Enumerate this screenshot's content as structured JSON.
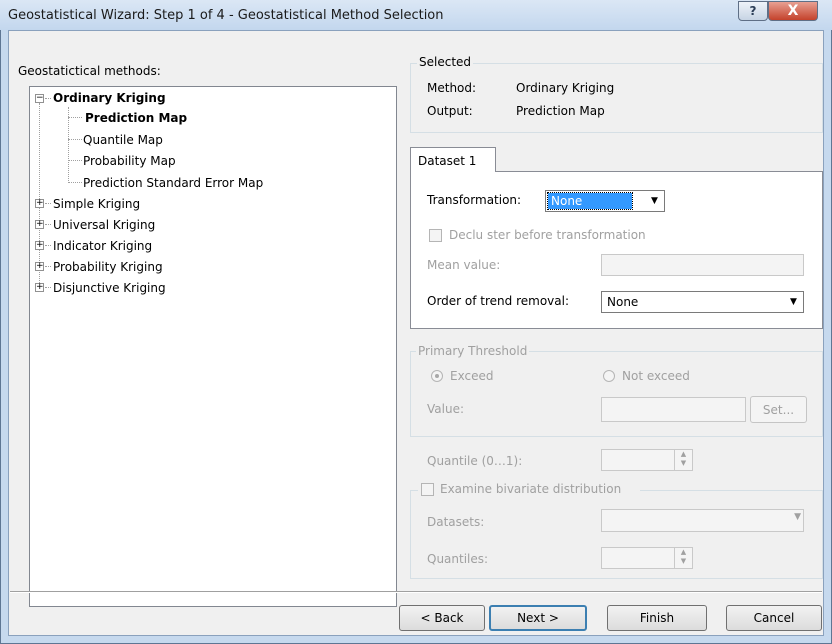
{
  "window": {
    "title": "Geostatistical Wizard: Step 1 of 4 - Geostatistical Method Selection",
    "help_glyph": "?",
    "close_glyph": "X"
  },
  "methods": {
    "label": "Geostatictical methods:",
    "tree": [
      {
        "label": "Ordinary Kriging",
        "expanded": true,
        "children": [
          "Prediction Map",
          "Quantile Map",
          "Probability Map",
          "Prediction Standard Error Map"
        ]
      },
      {
        "label": "Simple Kriging",
        "expanded": false
      },
      {
        "label": "Universal Kriging",
        "expanded": false
      },
      {
        "label": "Indicator Kriging",
        "expanded": false
      },
      {
        "label": "Probability Kriging",
        "expanded": false
      },
      {
        "label": "Disjunctive Kriging",
        "expanded": false
      }
    ],
    "collapse_glyph": "−",
    "expand_glyph": "+"
  },
  "selected": {
    "group_label": "Selected",
    "method_label": "Method:",
    "method_value": "Ordinary Kriging",
    "output_label": "Output:",
    "output_value": "Prediction Map"
  },
  "dataset": {
    "tab_label": "Dataset 1",
    "transformation_label": "Transformation:",
    "transformation_value": "None",
    "decluster_label": "Declu ster before transformation",
    "mean_value_label": "Mean value:",
    "trend_label": "Order of trend removal:",
    "trend_value": "None",
    "dropdown_glyph": "▼"
  },
  "threshold": {
    "group_label": "Primary Threshold",
    "exceed_label": "Exceed",
    "not_exceed_label": "Not exceed",
    "value_label": "Value:",
    "set_label": "Set..."
  },
  "quantile": {
    "label": "Quantile (0…1):"
  },
  "bivariate": {
    "label": "Examine bivariate distribution",
    "datasets_label": "Datasets:",
    "quantiles_label": "Quantiles:"
  },
  "buttons": {
    "back": "< Back",
    "next": "Next >",
    "finish": "Finish",
    "cancel": "Cancel"
  },
  "colors": {
    "selection_highlight": "#3399ff",
    "titlebar": "#c9dbef",
    "close_button": "#c9503b"
  }
}
